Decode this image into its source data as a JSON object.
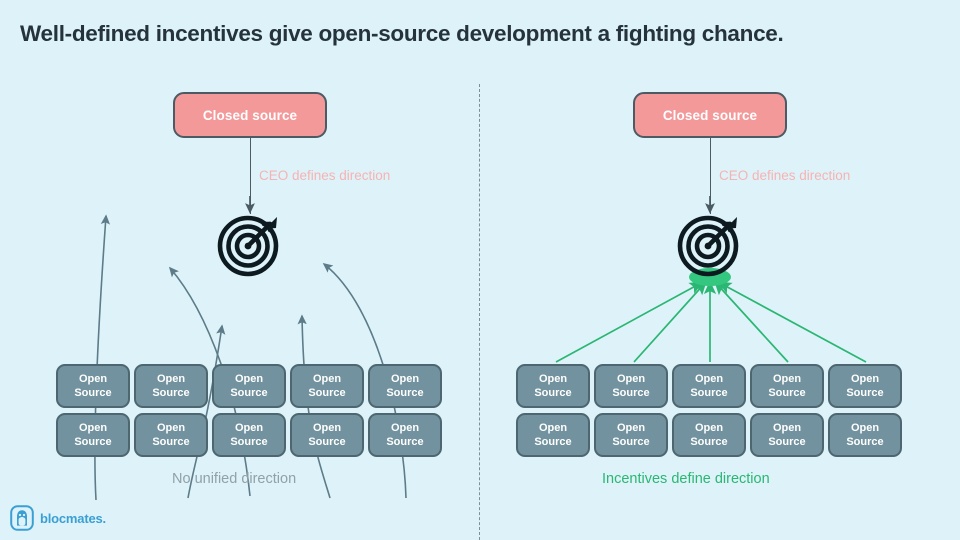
{
  "page": {
    "title": "Well-defined incentives give open-source development a fighting chance.",
    "background_color": "#ddf3f9",
    "title_color": "#26333d"
  },
  "colors": {
    "closed_source_fill": "#f4999a",
    "closed_source_border": "#4b5a63",
    "open_source_fill": "#71929e",
    "open_source_border": "#4e6670",
    "ceo_label_pink": "#f6b3b3",
    "gray_arrow": "#5d7b88",
    "green_arrow": "#2bb673",
    "caption_gray": "#92a0a8",
    "caption_green": "#2bb673",
    "divider": "#7d8f99",
    "logo_blue": "#3b9fd4"
  },
  "panels": {
    "left": {
      "name": "no-unified-direction-panel",
      "closed_source_label": "Closed source",
      "ceo_label": "CEO defines direction",
      "target_icon": "target-bullseye-icon",
      "open_source_boxes": [
        {
          "line1": "Open",
          "line2": "Source"
        },
        {
          "line1": "Open",
          "line2": "Source"
        },
        {
          "line1": "Open",
          "line2": "Source"
        },
        {
          "line1": "Open",
          "line2": "Source"
        },
        {
          "line1": "Open",
          "line2": "Source"
        },
        {
          "line1": "Open",
          "line2": "Source"
        },
        {
          "line1": "Open",
          "line2": "Source"
        },
        {
          "line1": "Open",
          "line2": "Source"
        },
        {
          "line1": "Open",
          "line2": "Source"
        },
        {
          "line1": "Open",
          "line2": "Source"
        }
      ],
      "caption": "No unified direction",
      "arrow_style": "scattered-curved-gray",
      "arrow_count": 5
    },
    "right": {
      "name": "incentives-define-direction-panel",
      "closed_source_label": "Closed source",
      "ceo_label": "CEO defines direction",
      "target_icon": "target-bullseye-icon",
      "open_source_boxes": [
        {
          "line1": "Open",
          "line2": "Source"
        },
        {
          "line1": "Open",
          "line2": "Source"
        },
        {
          "line1": "Open",
          "line2": "Source"
        },
        {
          "line1": "Open",
          "line2": "Source"
        },
        {
          "line1": "Open",
          "line2": "Source"
        },
        {
          "line1": "Open",
          "line2": "Source"
        },
        {
          "line1": "Open",
          "line2": "Source"
        },
        {
          "line1": "Open",
          "line2": "Source"
        },
        {
          "line1": "Open",
          "line2": "Source"
        },
        {
          "line1": "Open",
          "line2": "Source"
        }
      ],
      "caption": "Incentives define direction",
      "arrow_style": "converging-straight-green",
      "arrow_count": 5
    }
  },
  "logo": {
    "mark": "blocmates-penguin-icon",
    "text": "blocmates."
  }
}
